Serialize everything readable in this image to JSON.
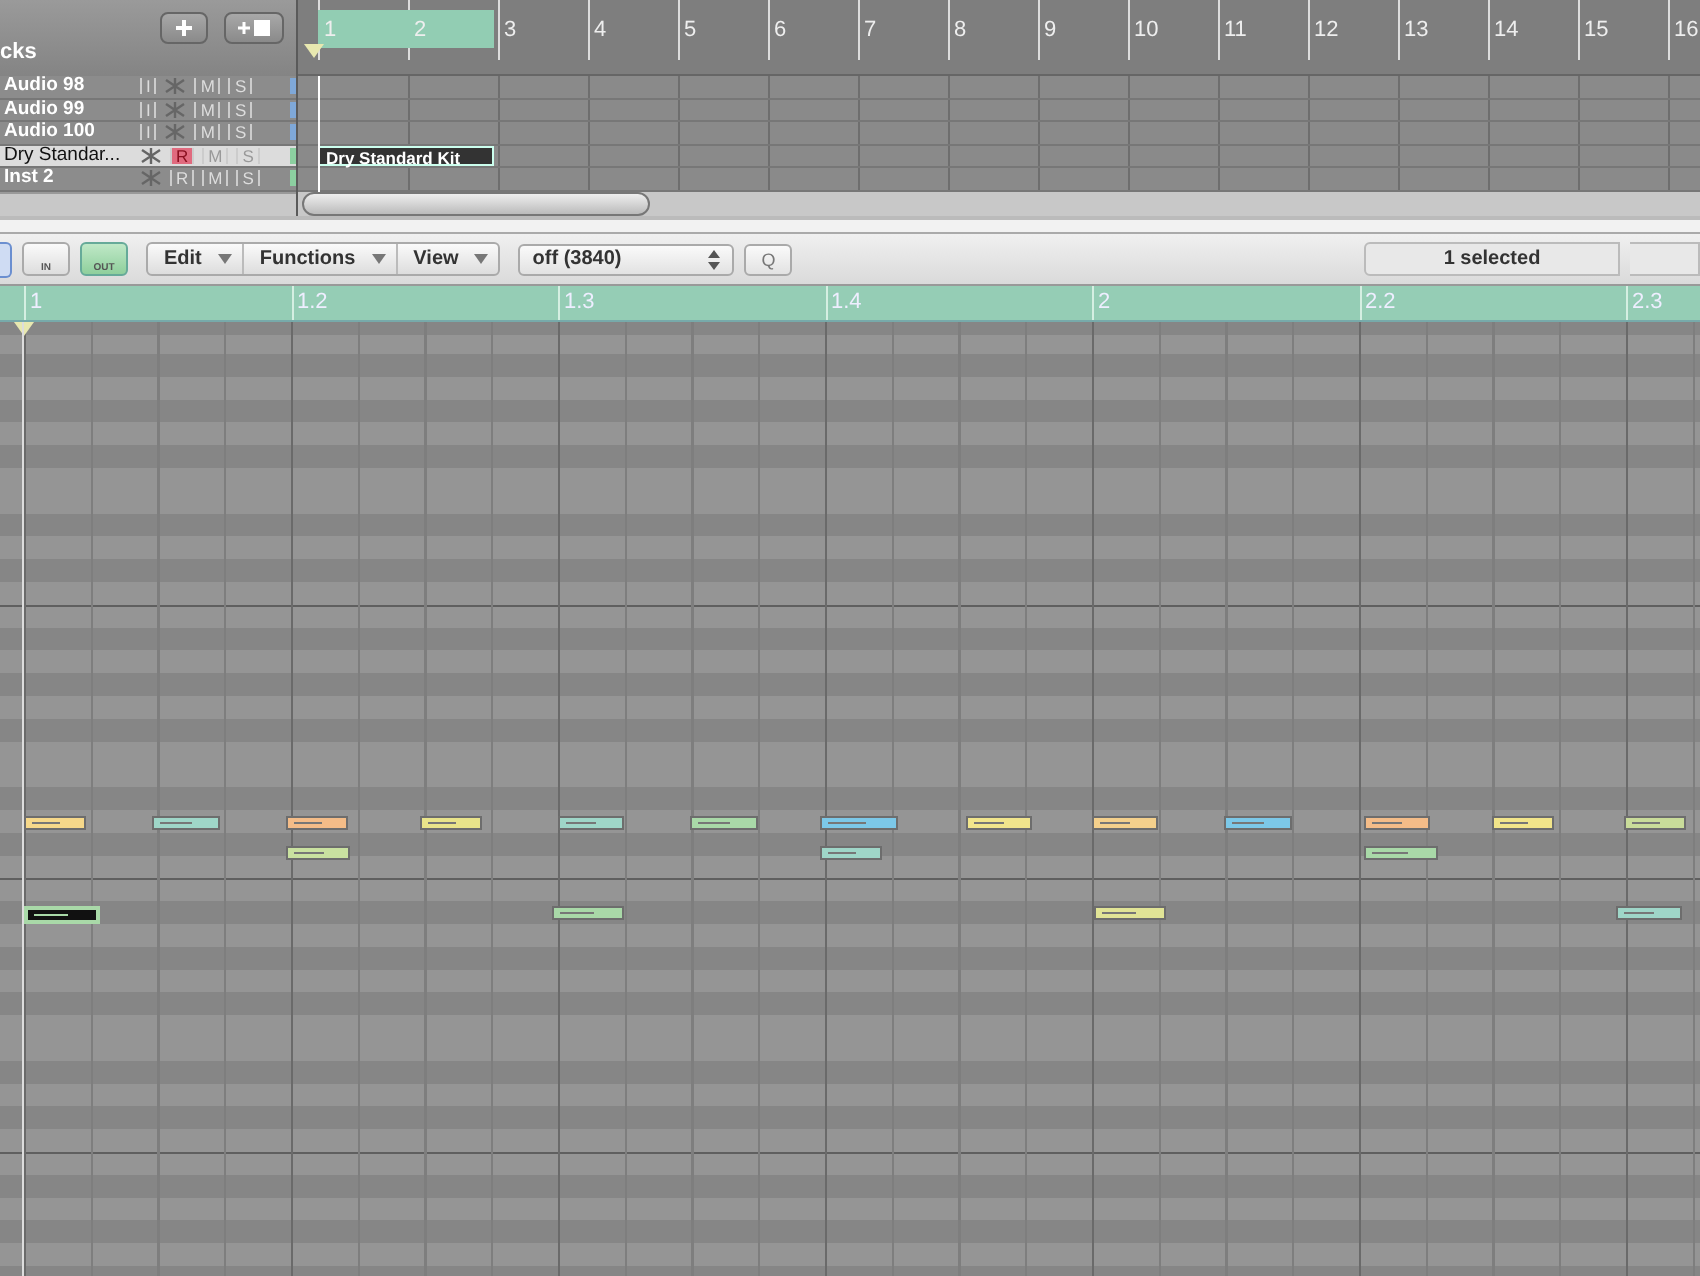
{
  "tracks_header": {
    "title": "cks"
  },
  "tracks": [
    {
      "name": "Audio 98",
      "selected": false,
      "color": "#7fa8d8",
      "buttons": [
        {
          "kind": "text",
          "label": "I",
          "on": false
        },
        {
          "kind": "freeze"
        },
        {
          "kind": "text",
          "label": "M",
          "on": false
        },
        {
          "kind": "text",
          "label": "S",
          "on": false
        }
      ]
    },
    {
      "name": "Audio 99",
      "selected": false,
      "color": "#7fa8d8",
      "buttons": [
        {
          "kind": "text",
          "label": "I",
          "on": false
        },
        {
          "kind": "freeze"
        },
        {
          "kind": "text",
          "label": "M",
          "on": false
        },
        {
          "kind": "text",
          "label": "S",
          "on": false
        }
      ]
    },
    {
      "name": "Audio 100",
      "selected": false,
      "color": "#7fa8d8",
      "buttons": [
        {
          "kind": "text",
          "label": "I",
          "on": false
        },
        {
          "kind": "freeze"
        },
        {
          "kind": "text",
          "label": "M",
          "on": false
        },
        {
          "kind": "text",
          "label": "S",
          "on": false
        }
      ]
    },
    {
      "name": "Dry Standar...",
      "selected": true,
      "color": "#8ccfa0",
      "buttons": [
        {
          "kind": "freeze"
        },
        {
          "kind": "text",
          "label": "R",
          "on": true
        },
        {
          "kind": "text",
          "label": "M",
          "on": false
        },
        {
          "kind": "text",
          "label": "S",
          "on": false
        }
      ]
    },
    {
      "name": "Inst 2",
      "selected": false,
      "color": "#8ccfa0",
      "buttons": [
        {
          "kind": "freeze"
        },
        {
          "kind": "text",
          "label": "R",
          "on": false
        },
        {
          "kind": "text",
          "label": "M",
          "on": false
        },
        {
          "kind": "text",
          "label": "S",
          "on": false
        }
      ]
    }
  ],
  "arrange_ruler": {
    "bars": [
      "1",
      "2",
      "3",
      "4",
      "5",
      "6",
      "7",
      "8",
      "9",
      "10",
      "11",
      "12",
      "13",
      "14",
      "15",
      "16"
    ]
  },
  "region": {
    "name": "Dry Standard Kit",
    "selected": true
  },
  "toolbar": {
    "midi_in": {
      "label": "IN",
      "on": false
    },
    "midi_out": {
      "label": "OUT",
      "on": true
    },
    "menus": [
      "Edit",
      "Functions",
      "View"
    ],
    "quantize": {
      "value": "off (3840)"
    },
    "q_button": "Q",
    "selection": "1 selected"
  },
  "pianoroll_ruler": {
    "labels": [
      "1",
      "1.2",
      "1.3",
      "1.4",
      "2",
      "2.2",
      "2.3"
    ]
  },
  "notes": [
    {
      "color": "#f6d88a",
      "selected": false
    },
    {
      "color": "#9fd6c8",
      "selected": false
    },
    {
      "color": "#f4bc88",
      "selected": false
    },
    {
      "color": "#e9e48a",
      "selected": false
    },
    {
      "color": "#9fd6c8",
      "selected": false
    },
    {
      "color": "#a9d9a8",
      "selected": false
    },
    {
      "color": "#7cc8e8",
      "selected": false
    },
    {
      "color": "#f1e58c",
      "selected": false
    },
    {
      "color": "#f4d08c",
      "selected": false
    },
    {
      "color": "#7cc8e8",
      "selected": false
    },
    {
      "color": "#f4bc88",
      "selected": false
    },
    {
      "color": "#f2e58a",
      "selected": false
    },
    {
      "color": "#c9dc9a",
      "selected": false
    },
    {
      "color": "#c9e1a0",
      "selected": false
    },
    {
      "color": "#9fd6c8",
      "selected": false
    },
    {
      "color": "#a9d9a8",
      "selected": false
    },
    {
      "color": "#a9d9a8",
      "selected": true
    },
    {
      "color": "#a9d9a8",
      "selected": false
    },
    {
      "color": "#e1e496",
      "selected": false
    },
    {
      "color": "#9fd6c8",
      "selected": false
    }
  ]
}
